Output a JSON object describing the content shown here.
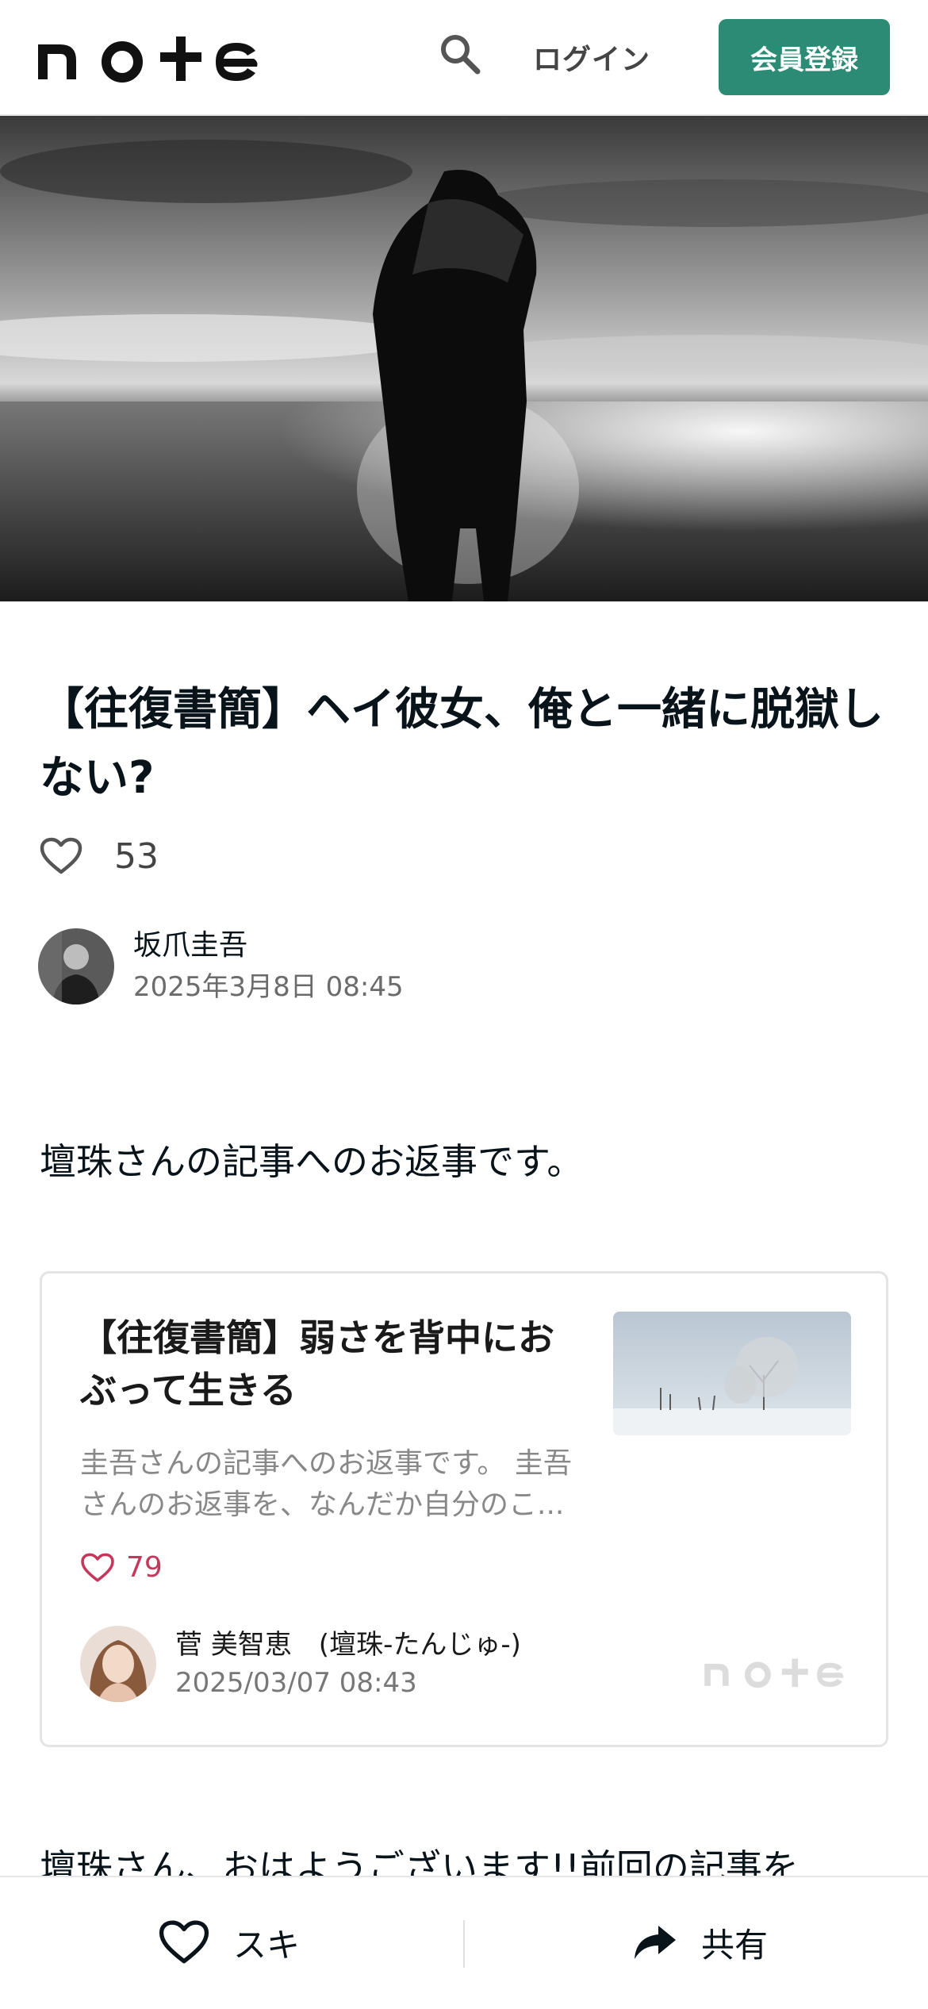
{
  "header": {
    "logo_text": "note",
    "login_label": "ログイン",
    "signup_label": "会員登録"
  },
  "icons": {
    "search": "search-icon",
    "heart": "heart-icon",
    "share": "share-icon"
  },
  "article": {
    "title_line1": "【往復書簡】ヘイ彼女、俺と一緒に脱獄し",
    "title_line2": "ない?",
    "like_count": "53",
    "author_name": "坂爪圭吾",
    "published": "2025年3月8日 08:45",
    "lead": "壇珠さんの記事へのお返事です。",
    "body_first_line": "壇珠さん、おはようございます!!前回の記事を"
  },
  "embed_card": {
    "title_line1": "【往復書簡】弱さを背中にお",
    "title_line2": "ぶって生きる",
    "excerpt_line1": "圭吾さんの記事へのお返事です。 圭吾",
    "excerpt_line2": "さんのお返事を、なんだか自分のこ...",
    "like_count": "79",
    "author_name": "菅 美智恵　(壇珠-たんじゅ-)",
    "date": "2025/03/07 08:43",
    "brand_mark": "note"
  },
  "bottom_bar": {
    "like_label": "スキ",
    "share_label": "共有"
  },
  "colors": {
    "brand_green": "#2b8b75",
    "like_pink": "#c4385c",
    "text": "#08131a"
  }
}
